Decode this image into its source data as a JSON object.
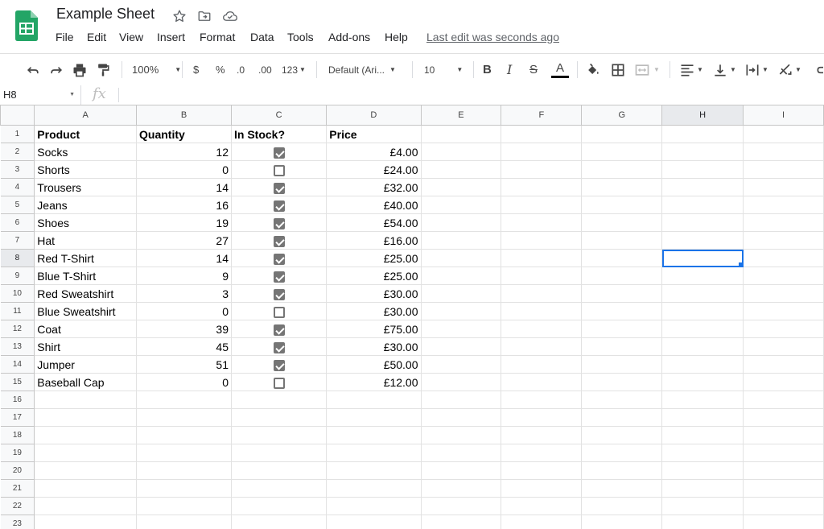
{
  "app": {
    "title": "Example Sheet",
    "last_edit": "Last edit was seconds ago",
    "brand_color": "#23a566"
  },
  "menu": [
    "File",
    "Edit",
    "View",
    "Insert",
    "Format",
    "Data",
    "Tools",
    "Add-ons",
    "Help"
  ],
  "toolbar": {
    "zoom": "100%",
    "currency": "$",
    "percent": "%",
    "decrease_decimals": ".0",
    "increase_decimals": ".00",
    "more_formats": "123",
    "font": "Default (Ari...",
    "font_size": "10",
    "bold": "B",
    "italic": "I",
    "strike": "S",
    "text_color_letter": "A"
  },
  "formula_bar": {
    "name_box": "H8",
    "fx": "fx",
    "value": ""
  },
  "columns": [
    "A",
    "B",
    "C",
    "D",
    "E",
    "F",
    "G",
    "H",
    "I"
  ],
  "selected_column": "H",
  "selected_row": "8",
  "header_row": {
    "product": "Product",
    "quantity": "Quantity",
    "in_stock": "In Stock?",
    "price": "Price"
  },
  "rows": [
    {
      "num": "1"
    },
    {
      "num": "2",
      "product": "Socks",
      "quantity": "12",
      "in_stock": true,
      "price": "£4.00"
    },
    {
      "num": "3",
      "product": "Shorts",
      "quantity": "0",
      "in_stock": false,
      "price": "£24.00"
    },
    {
      "num": "4",
      "product": "Trousers",
      "quantity": "14",
      "in_stock": true,
      "price": "£32.00"
    },
    {
      "num": "5",
      "product": "Jeans",
      "quantity": "16",
      "in_stock": true,
      "price": "£40.00"
    },
    {
      "num": "6",
      "product": "Shoes",
      "quantity": "19",
      "in_stock": true,
      "price": "£54.00"
    },
    {
      "num": "7",
      "product": "Hat",
      "quantity": "27",
      "in_stock": true,
      "price": "£16.00"
    },
    {
      "num": "8",
      "product": "Red T-Shirt",
      "quantity": "14",
      "in_stock": true,
      "price": "£25.00"
    },
    {
      "num": "9",
      "product": "Blue T-Shirt",
      "quantity": "9",
      "in_stock": true,
      "price": "£25.00"
    },
    {
      "num": "10",
      "product": "Red Sweatshirt",
      "quantity": "3",
      "in_stock": true,
      "price": "£30.00"
    },
    {
      "num": "11",
      "product": "Blue Sweatshirt",
      "quantity": "0",
      "in_stock": false,
      "price": "£30.00"
    },
    {
      "num": "12",
      "product": "Coat",
      "quantity": "39",
      "in_stock": true,
      "price": "£75.00"
    },
    {
      "num": "13",
      "product": "Shirt",
      "quantity": "45",
      "in_stock": true,
      "price": "£30.00"
    },
    {
      "num": "14",
      "product": "Jumper",
      "quantity": "51",
      "in_stock": true,
      "price": "£50.00"
    },
    {
      "num": "15",
      "product": "Baseball Cap",
      "quantity": "0",
      "in_stock": false,
      "price": "£12.00"
    },
    {
      "num": "16"
    },
    {
      "num": "17"
    },
    {
      "num": "18"
    },
    {
      "num": "19"
    },
    {
      "num": "20"
    },
    {
      "num": "21"
    },
    {
      "num": "22"
    },
    {
      "num": "23"
    }
  ],
  "colors": {
    "selection": "#1a73e8",
    "checkbox": "#757575"
  }
}
